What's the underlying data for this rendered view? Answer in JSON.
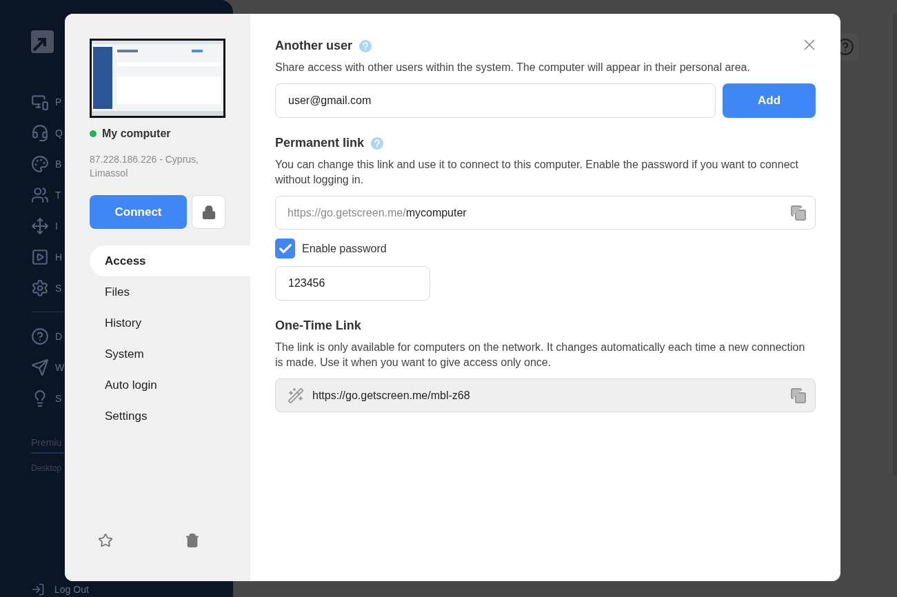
{
  "background": {
    "sidebar": {
      "items": [
        {
          "label": "P"
        },
        {
          "label": "Q"
        },
        {
          "label": "B"
        },
        {
          "label": "T"
        },
        {
          "label": "I"
        },
        {
          "label": "H"
        },
        {
          "label": "S"
        },
        {
          "label": "D"
        },
        {
          "label": "W"
        },
        {
          "label": "S"
        }
      ],
      "plan": "Premiu",
      "plan_sub": "Desktop",
      "logout": "Log Out"
    }
  },
  "dialog": {
    "computer": {
      "name": "My computer",
      "online": true,
      "address": "87.228.186.226 - Cyprus, Limassol",
      "connect": "Connect"
    },
    "nav": [
      {
        "label": "Access",
        "selected": true
      },
      {
        "label": "Files",
        "selected": false
      },
      {
        "label": "History",
        "selected": false
      },
      {
        "label": "System",
        "selected": false
      },
      {
        "label": "Auto login",
        "selected": false
      },
      {
        "label": "Settings",
        "selected": false
      }
    ],
    "another_user": {
      "title": "Another user",
      "description": "Share access with other users within the system. The computer will appear in their personal area.",
      "value": "user@gmail.com",
      "button": "Add"
    },
    "permanent_link": {
      "title": "Permanent link",
      "description": "You can change this link and use it to connect to this computer. Enable the password if you want to connect without logging in.",
      "prefix": "https://go.getscreen.me/",
      "value": "mycomputer",
      "password_enabled": true,
      "password_label": "Enable password",
      "password": "123456"
    },
    "one_time_link": {
      "title": "One-Time Link",
      "description": "The link is only available for computers on the network. It changes automatically each time a new connection is made. Use it when you want to give access only once.",
      "value": "https://go.getscreen.me/mbl-z68"
    }
  }
}
